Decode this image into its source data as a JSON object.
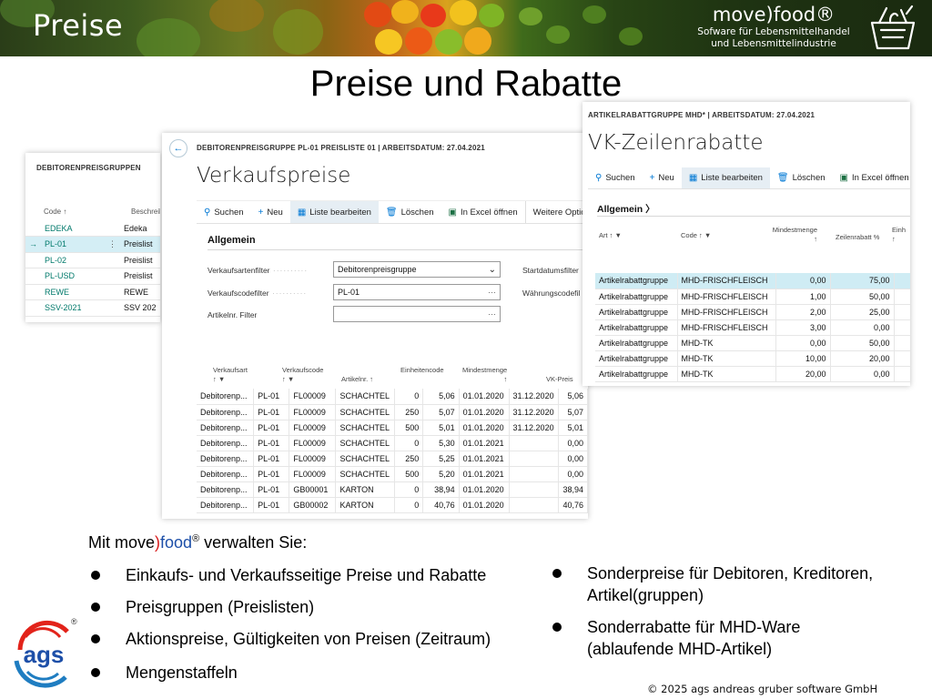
{
  "banner": {
    "title": "Preise",
    "brand_name": "move)food®",
    "brand_sub1": "Sofware für Lebensmittelhandel",
    "brand_sub2": "und Lebensmittelindustrie"
  },
  "main_title": "Preise und Rabatte",
  "groups": {
    "caption": "DEBITORENPREISGRUPPEN",
    "col_code": "Code ↑",
    "col_desc": "Beschreib",
    "rows": [
      {
        "code": "EDEKA",
        "desc": "Edeka"
      },
      {
        "code": "PL-01",
        "desc": "Preislist"
      },
      {
        "code": "PL-02",
        "desc": "Preislist"
      },
      {
        "code": "PL-USD",
        "desc": "Preislist"
      },
      {
        "code": "REWE",
        "desc": "REWE"
      },
      {
        "code": "SSV-2021",
        "desc": "SSV 202"
      }
    ],
    "selected_marker": "→",
    "more_marker": "⋮"
  },
  "prices": {
    "caption": "DEBITORENPREISGRUPPE PL-01 PREISLISTE 01 | ARBEITSDATUM: 27.04.2021",
    "title": "Verkaufspreise",
    "actions": {
      "search": "Suchen",
      "new": "Neu",
      "edit_list": "Liste bearbeiten",
      "delete": "Löschen",
      "excel": "In Excel öffnen",
      "more": "Weitere Optio"
    },
    "section": "Allgemein",
    "filters": {
      "sales_type_label": "Verkaufsartenfilter",
      "sales_type_value": "Debitorenpreisgruppe",
      "sales_code_label": "Verkaufscodefilter",
      "sales_code_value": "PL-01",
      "item_label": "Artikelnr. Filter",
      "start_date_label": "Startdatumsfilter",
      "currency_label": "Währungscodefil",
      "ellipsis": "···"
    },
    "columns": {
      "sales_type": "Verkaufsart",
      "sales_code": "Verkaufscode",
      "item_no": "Artikelnr. ↑",
      "unit": "Einheitencode",
      "min_qty": "Mindestmenge",
      "price": "VK-Preis",
      "sort_markers": "↑ ▼"
    },
    "rows": [
      {
        "type": "Debitorenp...",
        "code": "PL-01",
        "item": "FL00009",
        "unit": "SCHACHTEL",
        "min": "0",
        "price": "5,06",
        "start": "01.01.2020",
        "end": "31.12.2020",
        "extra": "5,06"
      },
      {
        "type": "Debitorenp...",
        "code": "PL-01",
        "item": "FL00009",
        "unit": "SCHACHTEL",
        "min": "250",
        "price": "5,07",
        "start": "01.01.2020",
        "end": "31.12.2020",
        "extra": "5,07"
      },
      {
        "type": "Debitorenp...",
        "code": "PL-01",
        "item": "FL00009",
        "unit": "SCHACHTEL",
        "min": "500",
        "price": "5,01",
        "start": "01.01.2020",
        "end": "31.12.2020",
        "extra": "5,01"
      },
      {
        "type": "Debitorenp...",
        "code": "PL-01",
        "item": "FL00009",
        "unit": "SCHACHTEL",
        "min": "0",
        "price": "5,30",
        "start": "01.01.2021",
        "end": "",
        "extra": "0,00"
      },
      {
        "type": "Debitorenp...",
        "code": "PL-01",
        "item": "FL00009",
        "unit": "SCHACHTEL",
        "min": "250",
        "price": "5,25",
        "start": "01.01.2021",
        "end": "",
        "extra": "0,00"
      },
      {
        "type": "Debitorenp...",
        "code": "PL-01",
        "item": "FL00009",
        "unit": "SCHACHTEL",
        "min": "500",
        "price": "5,20",
        "start": "01.01.2021",
        "end": "",
        "extra": "0,00"
      },
      {
        "type": "Debitorenp...",
        "code": "PL-01",
        "item": "GB00001",
        "unit": "KARTON",
        "min": "0",
        "price": "38,94",
        "start": "01.01.2020",
        "end": "",
        "extra": "38,94"
      },
      {
        "type": "Debitorenp...",
        "code": "PL-01",
        "item": "GB00002",
        "unit": "KARTON",
        "min": "0",
        "price": "40,76",
        "start": "01.01.2020",
        "end": "",
        "extra": "40,76"
      }
    ]
  },
  "discounts": {
    "caption": "ARTIKELRABATTGRUPPE MHD* | ARBEITSDATUM: 27.04.2021",
    "title": "VK-Zeilenrabatte",
    "actions": {
      "search": "Suchen",
      "new": "Neu",
      "edit_list": "Liste bearbeiten",
      "delete": "Löschen",
      "excel": "In Excel öffnen"
    },
    "section": "Allgemein",
    "section_chevron": "〉",
    "columns": {
      "type": "Art ↑ ▼",
      "code": "Code ↑ ▼",
      "min_qty": "Mindestmenge",
      "min_arrow": "↑",
      "discount": "Zeilenrabatt %",
      "unit": "Einh",
      "unit_arrow": "↑"
    },
    "rows": [
      {
        "type": "Artikelrabattgruppe",
        "code": "MHD-FRISCHFLEISCH",
        "min": "0,00",
        "disc": "75,00"
      },
      {
        "type": "Artikelrabattgruppe",
        "code": "MHD-FRISCHFLEISCH",
        "min": "1,00",
        "disc": "50,00"
      },
      {
        "type": "Artikelrabattgruppe",
        "code": "MHD-FRISCHFLEISCH",
        "min": "2,00",
        "disc": "25,00"
      },
      {
        "type": "Artikelrabattgruppe",
        "code": "MHD-FRISCHFLEISCH",
        "min": "3,00",
        "disc": "0,00"
      },
      {
        "type": "Artikelrabattgruppe",
        "code": "MHD-TK",
        "min": "0,00",
        "disc": "50,00"
      },
      {
        "type": "Artikelrabattgruppe",
        "code": "MHD-TK",
        "min": "10,00",
        "disc": "20,00"
      },
      {
        "type": "Artikelrabattgruppe",
        "code": "MHD-TK",
        "min": "20,00",
        "disc": "0,00"
      }
    ]
  },
  "bottom": {
    "intro_pre": "Mit move",
    "intro_paren": ")",
    "intro_food": "food",
    "intro_reg": "®",
    "intro_post": " verwalten Sie:",
    "left_bullets": [
      "Einkaufs- und Verkaufsseitige Preise und Rabatte",
      "Preisgruppen (Preislisten)",
      "Aktionspreise, Gültigkeiten von Preisen (Zeitraum)",
      "Mengenstaffeln"
    ],
    "right_bullets": [
      {
        "line1": "Sonderpreise für Debitoren, Kreditoren,",
        "line2": "Artikel(gruppen)"
      },
      {
        "line1": "Sonderrabatte für MHD-Ware",
        "line2": "(ablaufende MHD-Artikel)"
      }
    ],
    "copyright": "© 2025 ags andreas gruber software GmbH",
    "logo_text": "ags",
    "logo_reg": "®"
  },
  "colors": {
    "teal": "#00796b",
    "selection": "#d4eef5",
    "brand_red": "#d81b1b",
    "brand_blue": "#1d4fa8"
  }
}
